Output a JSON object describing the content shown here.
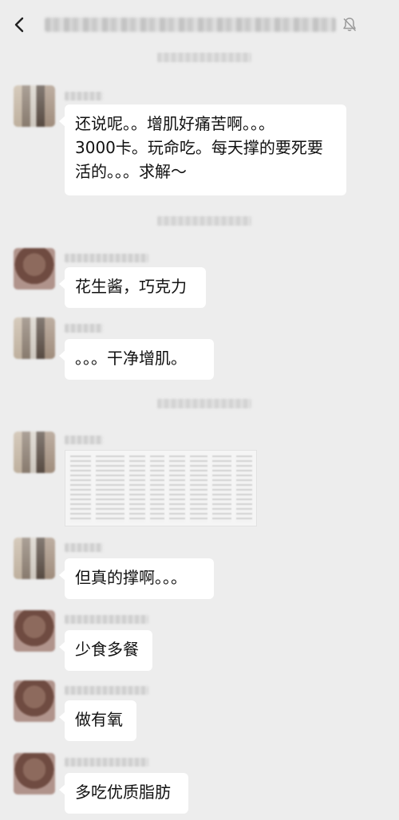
{
  "header": {
    "title": "",
    "back_icon": "chevron-left-icon",
    "mute_icon": "bell-muted-icon"
  },
  "messages": [
    {
      "text": "还说呢。。增肌好痛苦啊。。。\n3000卡。玩命吃。每天撑的要死要\n活的。。。求解～"
    },
    {
      "text": "花生酱，巧克力"
    },
    {
      "text": "。。。干净增肌。"
    },
    {
      "image": "spreadsheet-screenshot"
    },
    {
      "text": "但真的撑啊。。。"
    },
    {
      "text": "少食多餐"
    },
    {
      "text": "做有氧"
    },
    {
      "text": "多吃优质脂肪"
    }
  ],
  "colors": {
    "background": "#ededed",
    "bubble": "#ffffff",
    "text": "#111111"
  }
}
